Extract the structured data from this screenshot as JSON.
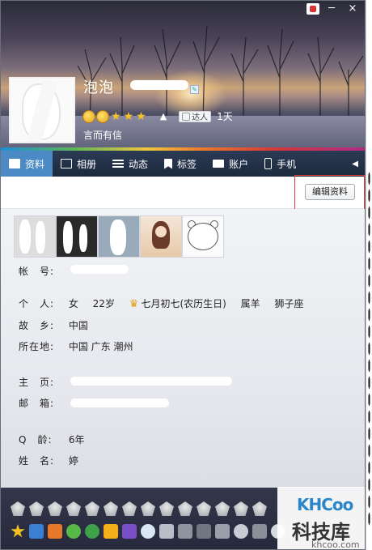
{
  "window": {
    "close_label": "×",
    "minimize_label": "─"
  },
  "profile": {
    "nickname": "泡泡",
    "signature": "言而有信",
    "badge_label": "达人",
    "days": "1天"
  },
  "tabs": [
    {
      "label": "资料",
      "icon": "profile-card-icon"
    },
    {
      "label": "相册",
      "icon": "photo-album-icon"
    },
    {
      "label": "动态",
      "icon": "list-icon"
    },
    {
      "label": "标签",
      "icon": "bookmark-icon"
    },
    {
      "label": "账户",
      "icon": "bag-icon"
    },
    {
      "label": "手机",
      "icon": "phone-icon"
    }
  ],
  "toolbar": {
    "edit_label": "编辑资料"
  },
  "info": {
    "account_label": "帐　号:",
    "personal_label": "个　人:",
    "gender": "女",
    "age": "22岁",
    "birthday": "七月初七(农历生日)",
    "zodiac": "属羊",
    "constellation": "狮子座",
    "hometown_label": "故　乡:",
    "hometown": "中国",
    "location_label": "所在地:",
    "location": "中国 广东 潮州",
    "homepage_label": "主　页:",
    "email_label": "邮　箱:",
    "qage_label": "Q　龄:",
    "qage": "6年",
    "realname_label": "姓　名:",
    "realname": "婷"
  },
  "watermark": {
    "top": "KHCoo",
    "main": "科技库",
    "sub": "khcoo.com"
  },
  "colors": {
    "tab_active": "#4b8ac4",
    "tabbar": "#1d2a3f",
    "edit_outline": "#e03a3a",
    "watermark_blue": "#2a86c8"
  }
}
